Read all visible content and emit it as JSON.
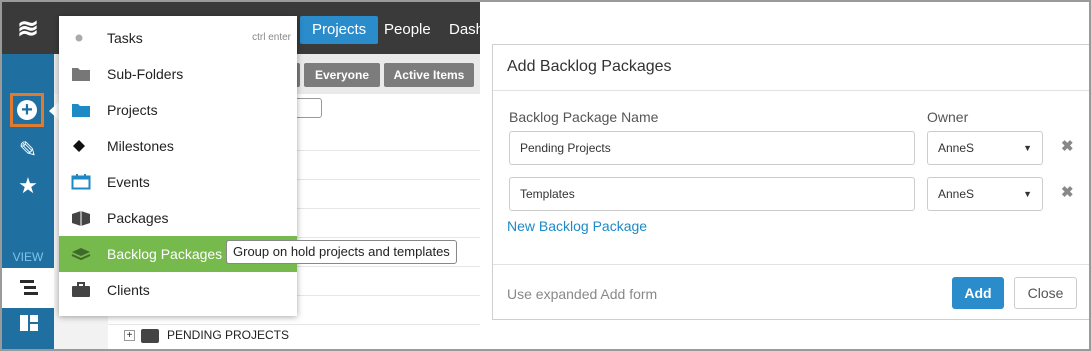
{
  "rail": {
    "logo_icon": "hamburger-logo-icon",
    "view_label": "VIEW"
  },
  "topnav": {
    "items": [
      {
        "label": "Projects",
        "active": true
      },
      {
        "label": "People",
        "active": false
      },
      {
        "label": "Dash",
        "active": false
      }
    ]
  },
  "filters": {
    "everyone": "Everyone",
    "active_items": "Active Items"
  },
  "list": {
    "pending_projects": "PENDING PROJECTS"
  },
  "menu": {
    "items": [
      {
        "label": "Tasks",
        "icon": "dot-icon",
        "shortcut": "ctrl enter"
      },
      {
        "label": "Sub-Folders",
        "icon": "folder-gray-icon"
      },
      {
        "label": "Projects",
        "icon": "folder-blue-icon"
      },
      {
        "label": "Milestones",
        "icon": "diamond-icon"
      },
      {
        "label": "Events",
        "icon": "calendar-icon"
      },
      {
        "label": "Packages",
        "icon": "package-icon"
      },
      {
        "label": "Backlog Packages",
        "icon": "layers-icon",
        "highlighted": true
      },
      {
        "label": "Clients",
        "icon": "briefcase-icon"
      }
    ],
    "tooltip": "Group on hold projects and templates"
  },
  "dialog": {
    "title": "Add Backlog Packages",
    "name_header": "Backlog Package Name",
    "owner_header": "Owner",
    "rows": [
      {
        "name": "Pending Projects",
        "owner": "AnneS"
      },
      {
        "name": "Templates",
        "owner": "AnneS"
      }
    ],
    "new_link": "New Backlog Package",
    "expanded_link": "Use expanded Add form",
    "add_label": "Add",
    "close_label": "Close"
  },
  "colors": {
    "rail": "#1f6fa1",
    "topbar": "#3a3a3a",
    "accent": "#2a8ccb",
    "highlight": "#76b94c",
    "focus_outline": "#e07a2e"
  }
}
